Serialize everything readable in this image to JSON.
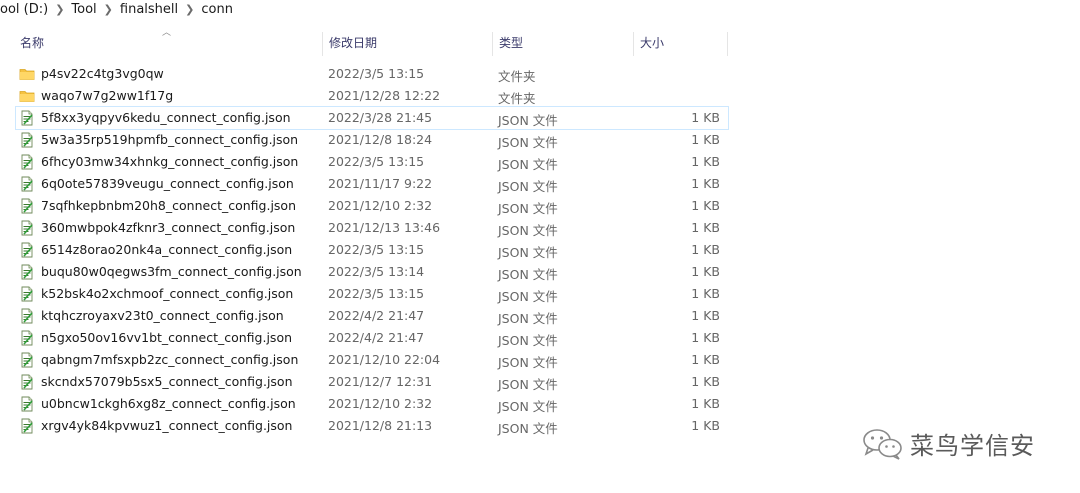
{
  "breadcrumb": [
    "ool (D:)",
    "Tool",
    "finalshell",
    "conn"
  ],
  "columns": {
    "name": "名称",
    "date": "修改日期",
    "type": "类型",
    "size": "大小"
  },
  "files": [
    {
      "name": "p4sv22c4tg3vg0qw",
      "date": "2022/3/5 13:15",
      "type": "文件夹",
      "size": "",
      "kind": "folder"
    },
    {
      "name": "waqo7w7g2ww1f17g",
      "date": "2021/12/28 12:22",
      "type": "文件夹",
      "size": "",
      "kind": "folder"
    },
    {
      "name": "5f8xx3yqpyv6kedu_connect_config.json",
      "date": "2022/3/28 21:45",
      "type": "JSON 文件",
      "size": "1 KB",
      "kind": "json",
      "selected": true
    },
    {
      "name": "5w3a35rp519hpmfb_connect_config.json",
      "date": "2021/12/8 18:24",
      "type": "JSON 文件",
      "size": "1 KB",
      "kind": "json"
    },
    {
      "name": "6fhcy03mw34xhnkg_connect_config.json",
      "date": "2022/3/5 13:15",
      "type": "JSON 文件",
      "size": "1 KB",
      "kind": "json"
    },
    {
      "name": "6q0ote57839veugu_connect_config.json",
      "date": "2021/11/17 9:22",
      "type": "JSON 文件",
      "size": "1 KB",
      "kind": "json"
    },
    {
      "name": "7sqfhkepbnbm20h8_connect_config.json",
      "date": "2021/12/10 2:32",
      "type": "JSON 文件",
      "size": "1 KB",
      "kind": "json"
    },
    {
      "name": "360mwbpok4zfknr3_connect_config.json",
      "date": "2021/12/13 13:46",
      "type": "JSON 文件",
      "size": "1 KB",
      "kind": "json"
    },
    {
      "name": "6514z8orao20nk4a_connect_config.json",
      "date": "2022/3/5 13:15",
      "type": "JSON 文件",
      "size": "1 KB",
      "kind": "json"
    },
    {
      "name": "buqu80w0qegws3fm_connect_config.json",
      "date": "2022/3/5 13:14",
      "type": "JSON 文件",
      "size": "1 KB",
      "kind": "json"
    },
    {
      "name": "k52bsk4o2xchmoof_connect_config.json",
      "date": "2022/3/5 13:15",
      "type": "JSON 文件",
      "size": "1 KB",
      "kind": "json"
    },
    {
      "name": "ktqhczroyaxv23t0_connect_config.json",
      "date": "2022/4/2 21:47",
      "type": "JSON 文件",
      "size": "1 KB",
      "kind": "json"
    },
    {
      "name": "n5gxo50ov16vv1bt_connect_config.json",
      "date": "2022/4/2 21:47",
      "type": "JSON 文件",
      "size": "1 KB",
      "kind": "json"
    },
    {
      "name": "qabngm7mfsxpb2zc_connect_config.json",
      "date": "2021/12/10 22:04",
      "type": "JSON 文件",
      "size": "1 KB",
      "kind": "json"
    },
    {
      "name": "skcndx57079b5sx5_connect_config.json",
      "date": "2021/12/7 12:31",
      "type": "JSON 文件",
      "size": "1 KB",
      "kind": "json"
    },
    {
      "name": "u0bncw1ckgh6xg8z_connect_config.json",
      "date": "2021/12/10 2:32",
      "type": "JSON 文件",
      "size": "1 KB",
      "kind": "json"
    },
    {
      "name": "xrgv4yk84kpvwuz1_connect_config.json",
      "date": "2021/12/8 21:13",
      "type": "JSON 文件",
      "size": "1 KB",
      "kind": "json"
    }
  ],
  "watermark": {
    "text": "菜鸟学信安",
    "icon": "wechat-icon"
  },
  "colors": {
    "folder": "#f5c242",
    "selection": "#cde8ff",
    "header_text": "#3a3a6a"
  }
}
